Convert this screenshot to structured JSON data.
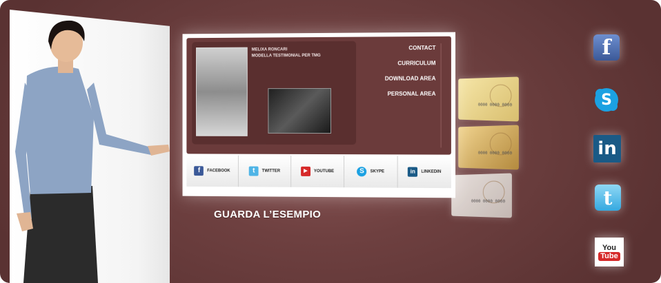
{
  "mockup": {
    "model_name_line1": "MELIXA RONCARI",
    "model_name_line2": "MODELLA TESTIMONIAL PER TMG",
    "menu": [
      "CONTACT",
      "CURRICULUM",
      "DOWNLOAD AREA",
      "PERSONAL AREA"
    ],
    "social_bar": [
      {
        "label": "FACEBOOK",
        "icon": "facebook-icon",
        "color": "#3b5998"
      },
      {
        "label": "TWITTER",
        "icon": "twitter-icon",
        "color": "#4fb4e6"
      },
      {
        "label": "YOUTUBE",
        "icon": "youtube-icon",
        "color": "#d62a2a"
      },
      {
        "label": "SKYPE",
        "icon": "skype-icon",
        "color": "#1ba1e2"
      },
      {
        "label": "LINKEDIN",
        "icon": "linkedin-icon",
        "color": "#1a5a86"
      }
    ]
  },
  "cards": {
    "number": "0000 0000 0000"
  },
  "cta_label": "GUARDA L’ESEMPIO",
  "side_icons": {
    "facebook_glyph": "f",
    "skype_glyph": "S",
    "linkedin_glyph": "in",
    "twitter_glyph": "t",
    "youtube_you": "You",
    "youtube_tube": "Tube"
  },
  "colors": {
    "background": "#6e4040",
    "accent_white": "#ffffff"
  }
}
